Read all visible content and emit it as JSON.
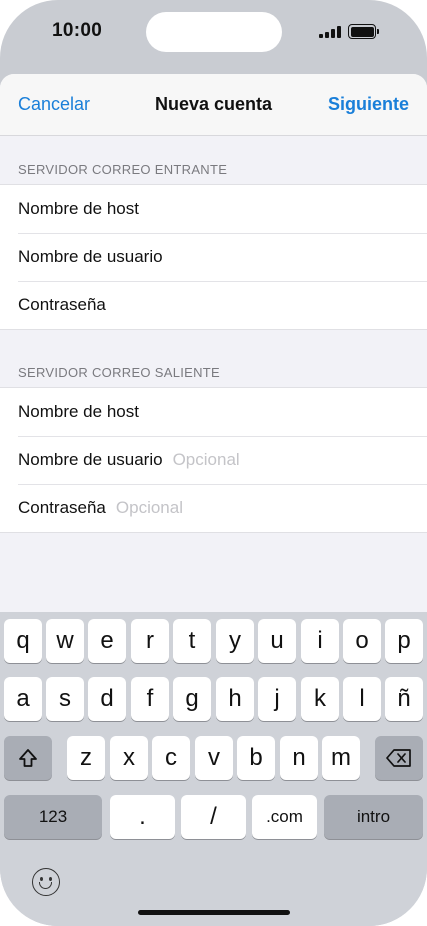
{
  "status": {
    "time": "10:00"
  },
  "nav": {
    "cancel": "Cancelar",
    "title": "Nueva cuenta",
    "next": "Siguiente"
  },
  "incoming": {
    "header": "SERVIDOR CORREO ENTRANTE",
    "rows": [
      {
        "label": "Nombre de host"
      },
      {
        "label": "Nombre de usuario"
      },
      {
        "label": "Contraseña"
      }
    ]
  },
  "outgoing": {
    "header": "SERVIDOR CORREO SALIENTE",
    "rows": [
      {
        "label": "Nombre de host"
      },
      {
        "label": "Nombre de usuario",
        "placeholder": "Opcional"
      },
      {
        "label": "Contraseña",
        "placeholder": "Opcional"
      }
    ]
  },
  "keyboard": {
    "row1": [
      "q",
      "w",
      "e",
      "r",
      "t",
      "y",
      "u",
      "i",
      "o",
      "p"
    ],
    "row2": [
      "a",
      "s",
      "d",
      "f",
      "g",
      "h",
      "j",
      "k",
      "l",
      "ñ"
    ],
    "row3": [
      "z",
      "x",
      "c",
      "v",
      "b",
      "n",
      "m"
    ],
    "numbers_key": "123",
    "dot_key": ".",
    "slash_key": "/",
    "com_key": ".com",
    "return_key": "intro",
    "icons": [
      "shift-icon",
      "backspace-icon",
      "emoji-icon"
    ]
  }
}
